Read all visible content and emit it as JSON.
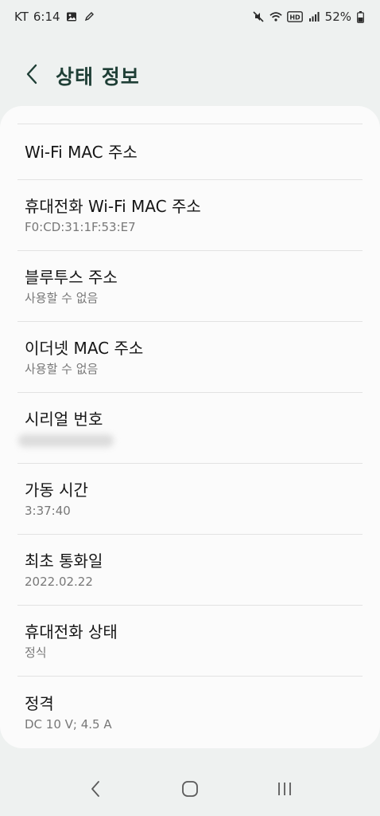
{
  "status_bar": {
    "carrier": "KT",
    "time": "6:14",
    "battery": "52%",
    "icons": [
      "image-icon",
      "pen-icon",
      "mute-icon",
      "wifi-icon",
      "hd-icon",
      "signal-icon",
      "battery-icon"
    ]
  },
  "header": {
    "title": "상태 정보",
    "back_icon": "chevron-left-icon"
  },
  "items": [
    {
      "title": "Wi-Fi MAC 주소",
      "subtitle": ""
    },
    {
      "title": "휴대전화 Wi-Fi MAC 주소",
      "subtitle": "F0:CD:31:1F:53:E7"
    },
    {
      "title": "블루투스 주소",
      "subtitle": "사용할 수 없음"
    },
    {
      "title": "이더넷 MAC 주소",
      "subtitle": "사용할 수 없음"
    },
    {
      "title": "시리얼 번호",
      "subtitle": ""
    },
    {
      "title": "가동 시간",
      "subtitle": "3:37:40"
    },
    {
      "title": "최초 통화일",
      "subtitle": "2022.02.22"
    },
    {
      "title": "휴대전화 상태",
      "subtitle": "정식"
    },
    {
      "title": "정격",
      "subtitle": "DC 10 V; 4.5 A"
    }
  ],
  "nav_bar": {
    "icons": [
      "back-nav-icon",
      "home-icon",
      "recents-icon"
    ]
  },
  "colors": {
    "background": "#eef1f0",
    "card": "#fbfbfb",
    "title_accent": "#1f3f36"
  }
}
